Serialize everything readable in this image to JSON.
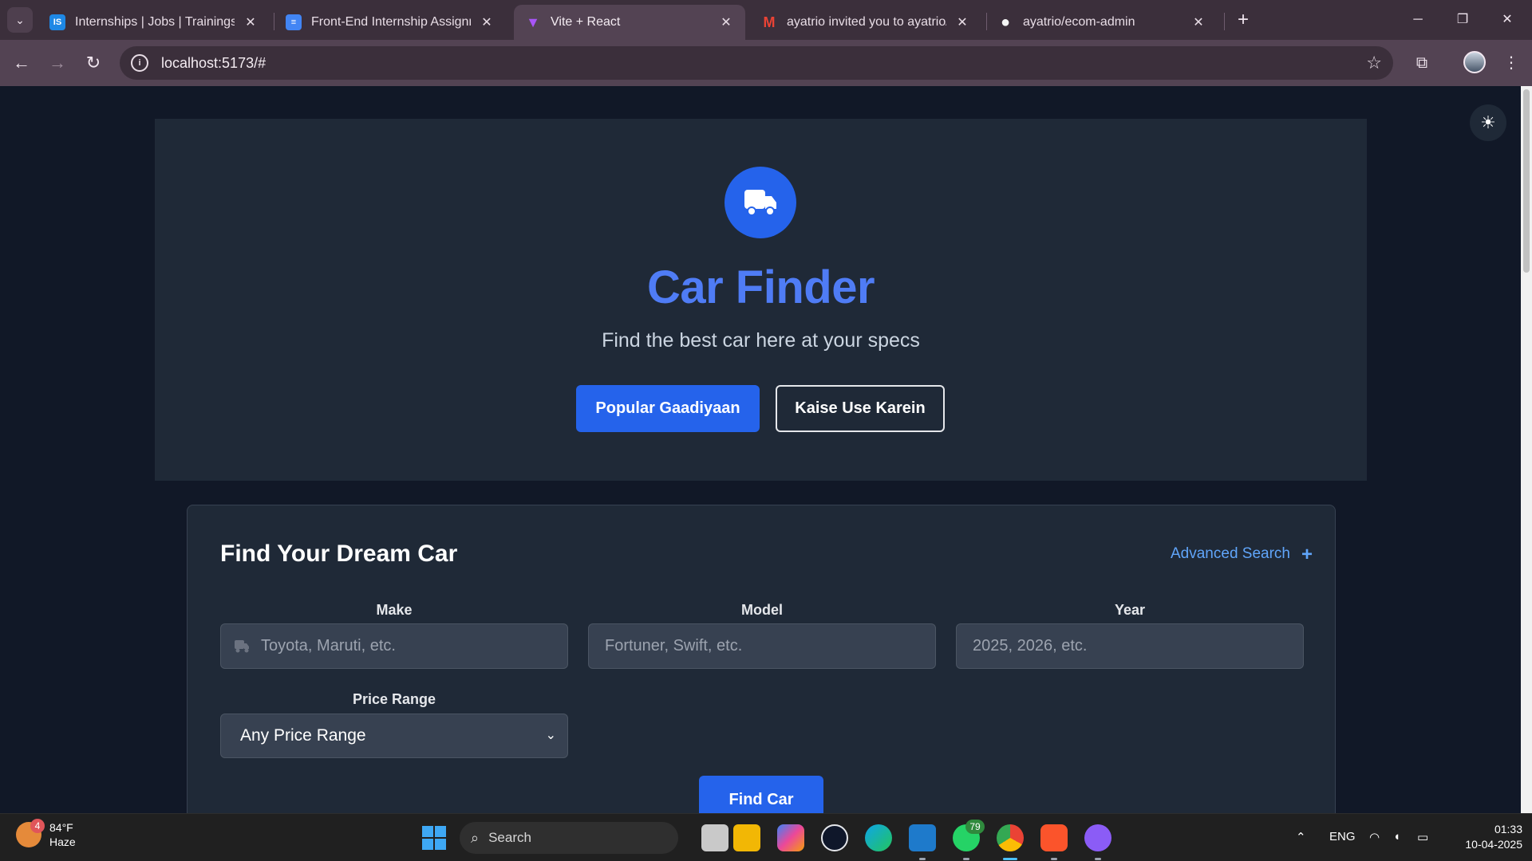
{
  "browser": {
    "tabs": [
      {
        "title": "Internships | Jobs | Trainings & More",
        "favicon_color": "#1e88e5",
        "favicon_text": "IS",
        "active": false
      },
      {
        "title": "Front-End Internship Assignment",
        "favicon_color": "#4285f4",
        "favicon_text": "≡",
        "active": false
      },
      {
        "title": "Vite + React",
        "favicon_color": "#a855f7",
        "favicon_text": "▼",
        "active": true
      },
      {
        "title": "ayatrio invited you to ayatrio/ecom-admin",
        "favicon_color": "#ea4335",
        "favicon_text": "M",
        "active": false
      },
      {
        "title": "ayatrio/ecom-admin",
        "favicon_color": "#f5f5f5",
        "favicon_text": "●",
        "active": false
      }
    ],
    "address": {
      "url": "localhost:5173/#"
    }
  },
  "page": {
    "hero": {
      "title": "Car Finder",
      "subtitle": "Find the best car here at your specs",
      "primary_button": "Popular Gaadiyaan",
      "secondary_button": "Kaise Use Karein"
    },
    "search": {
      "title": "Find Your Dream Car",
      "advanced_link": "Advanced Search",
      "fields": {
        "make": {
          "label": "Make",
          "placeholder": "Toyota, Maruti, etc."
        },
        "model": {
          "label": "Model",
          "placeholder": "Fortuner, Swift, etc."
        },
        "year": {
          "label": "Year",
          "placeholder": "2025, 2026, etc."
        }
      },
      "price_range": {
        "label": "Price Range",
        "selected": "Any Price Range"
      },
      "submit": "Find Car"
    }
  },
  "taskbar": {
    "weather": {
      "temp": "84°F",
      "condition": "Haze",
      "badge": "4"
    },
    "search_label": "Search",
    "whatsapp_count": "79",
    "language": "ENG",
    "time": "01:33",
    "date": "10-04-2025"
  },
  "colors": {
    "accent": "#2563eb",
    "title_blue": "#4f7cf5",
    "page_bg": "#111827",
    "card_bg": "#1f2937"
  }
}
